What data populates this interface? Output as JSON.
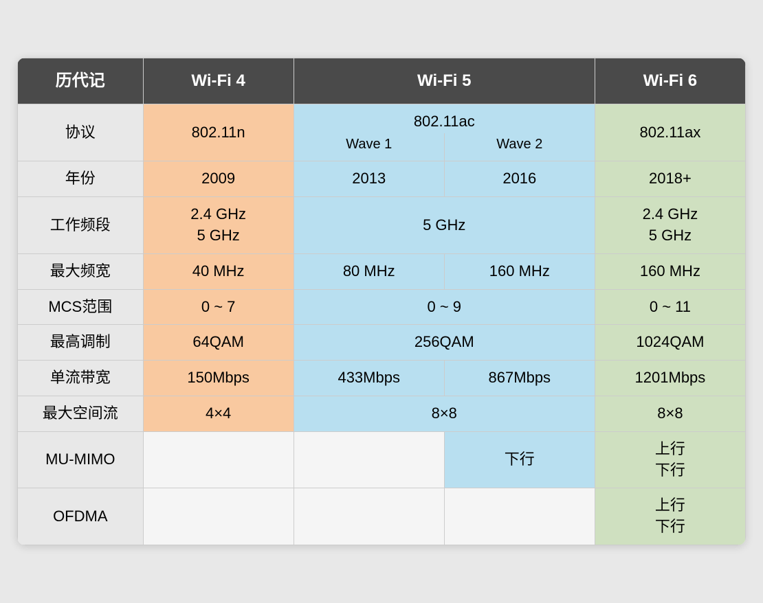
{
  "header": {
    "col_label": "历代记",
    "col_wifi4": "Wi-Fi 4",
    "col_wifi5": "Wi-Fi 5",
    "col_wifi6": "Wi-Fi 6"
  },
  "wifi5_subheader": {
    "protocol": "802.11ac",
    "wave1": "Wave 1",
    "wave2": "Wave 2"
  },
  "rows": {
    "protocol": {
      "label": "协议",
      "wifi4": "802.11n",
      "wifi5_merged": "802.11ac",
      "wifi6": "802.11ax"
    },
    "year": {
      "label": "年份",
      "wifi4": "2009",
      "wave1": "2013",
      "wave2": "2016",
      "wifi6": "2018+"
    },
    "freq": {
      "label": "工作频段",
      "wifi4_line1": "2.4 GHz",
      "wifi4_line2": "5 GHz",
      "wifi5_merged": "5 GHz",
      "wifi6_line1": "2.4 GHz",
      "wifi6_line2": "5 GHz"
    },
    "bandwidth": {
      "label": "最大频宽",
      "wifi4": "40 MHz",
      "wave1": "80 MHz",
      "wave2": "160 MHz",
      "wifi6": "160 MHz"
    },
    "mcs": {
      "label": "MCS范围",
      "wifi4": "0 ~ 7",
      "wifi5_merged": "0 ~ 9",
      "wifi6": "0 ~ 11"
    },
    "modulation": {
      "label": "最高调制",
      "wifi4": "64QAM",
      "wifi5_merged": "256QAM",
      "wifi6": "1024QAM"
    },
    "single_stream": {
      "label": "单流带宽",
      "wifi4": "150Mbps",
      "wave1": "433Mbps",
      "wave2": "867Mbps",
      "wifi6": "1201Mbps"
    },
    "spatial_streams": {
      "label": "最大空间流",
      "wifi4": "4×4",
      "wifi5_merged": "8×8",
      "wifi6": "8×8"
    },
    "mu_mimo": {
      "label": "MU-MIMO",
      "wifi4": "",
      "wave1": "",
      "wave2": "下行",
      "wifi6_line1": "上行",
      "wifi6_line2": "下行"
    },
    "ofdma": {
      "label": "OFDMA",
      "wifi4": "",
      "wave1": "",
      "wave2": "",
      "wifi6_line1": "上行",
      "wifi6_line2": "下行"
    }
  }
}
